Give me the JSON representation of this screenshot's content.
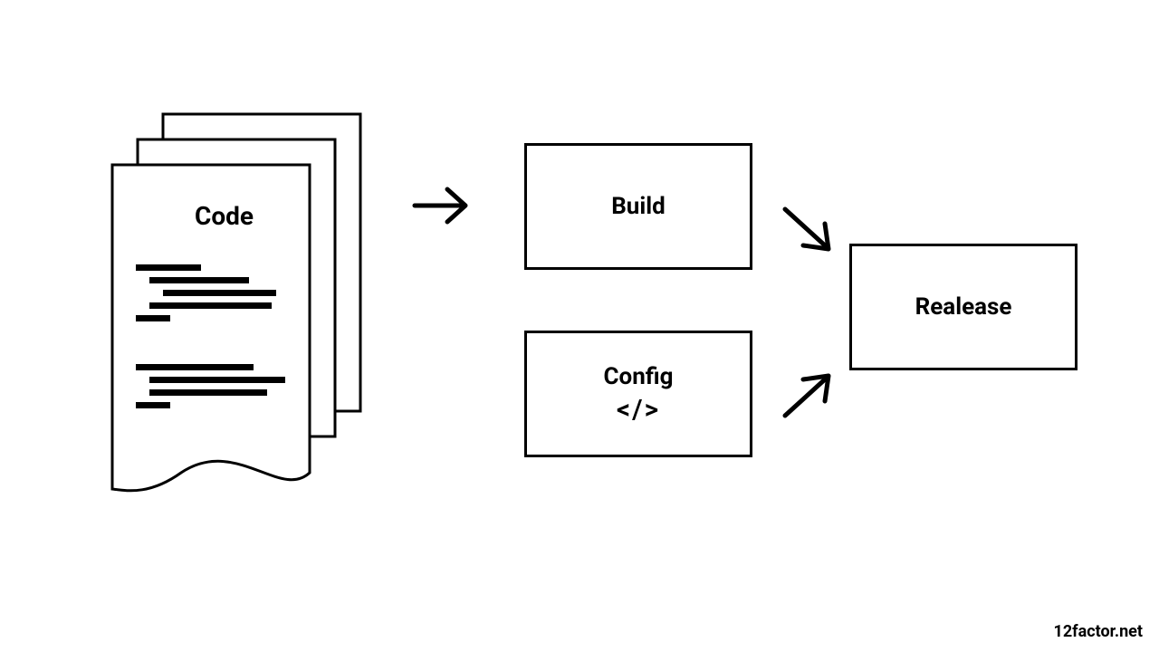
{
  "diagram": {
    "nodes": {
      "code": {
        "label": "Code"
      },
      "build": {
        "label": "Build"
      },
      "config": {
        "label": "Config",
        "icon_text": "</>"
      },
      "release": {
        "label": "Realease"
      }
    },
    "edges": [
      {
        "from": "code",
        "to": "build"
      },
      {
        "from": "build",
        "to": "release"
      },
      {
        "from": "config",
        "to": "release"
      }
    ],
    "attribution": "12factor.net"
  }
}
